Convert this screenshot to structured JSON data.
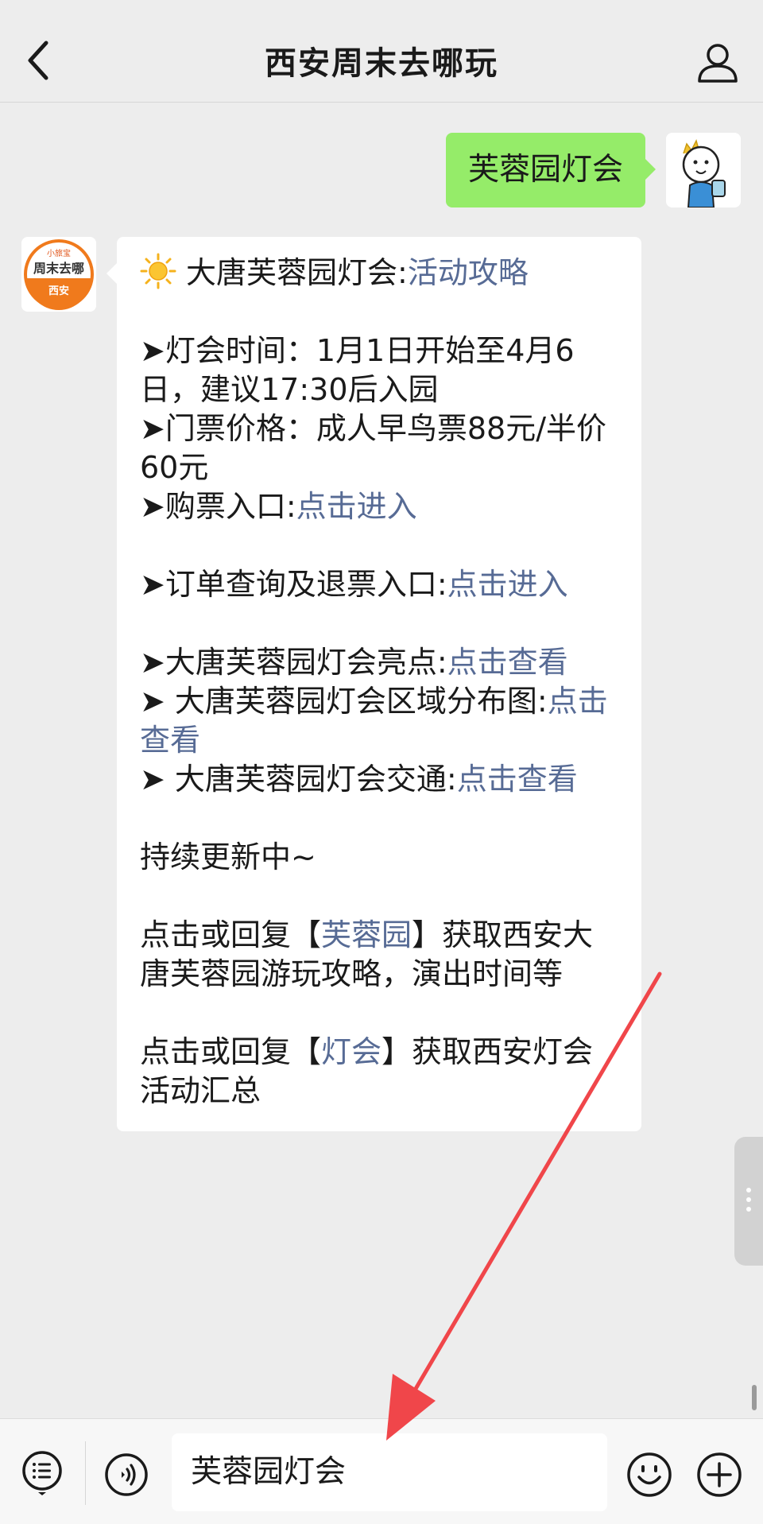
{
  "nav": {
    "title": "西安周末去哪玩",
    "back_icon": "chevron-left-icon",
    "profile_icon": "person-icon"
  },
  "outgoing_message": {
    "text": "芙蓉园灯会"
  },
  "bot_avatar": {
    "line1": "小旅宝",
    "line2": "周末去哪",
    "line3": "西安"
  },
  "reply": {
    "headline_icon": "sun-icon",
    "headline_text": "大唐芙蓉园灯会:",
    "headline_link": "活动攻略",
    "time_line": "➤灯会时间：1月1日开始至4月6日，建议17:30后入园",
    "price_line": "➤门票价格：成人早鸟票88元/半价60元",
    "buy_label": "➤购票入口:",
    "buy_link": "点击进入",
    "order_label": "➤订单查询及退票入口:",
    "order_link": "点击进入",
    "highlights_label": "➤大唐芙蓉园灯会亮点:",
    "highlights_link": "点击查看",
    "map_label": "➤ 大唐芙蓉园灯会区域分布图:",
    "map_link": "点击查看",
    "traffic_label": "➤ 大唐芙蓉园灯会交通:",
    "traffic_link": "点击查看",
    "updating": "持续更新中~",
    "tip1_prefix": "点击或回复【",
    "tip1_link": "芙蓉园",
    "tip1_suffix": "】获取西安大唐芙蓉园游玩攻略，演出时间等",
    "tip2_prefix": "点击或回复【",
    "tip2_link": "灯会",
    "tip2_suffix": "】获取西安灯会活动汇总"
  },
  "input": {
    "value": "芙蓉园灯会"
  },
  "bottom_icons": [
    "menu-icon",
    "voice-icon",
    "emoji-icon",
    "plus-icon"
  ],
  "colors": {
    "background": "#ededed",
    "outgoing_bubble": "#95ec69",
    "link": "#576b95",
    "annotation_arrow": "#f0464a"
  }
}
